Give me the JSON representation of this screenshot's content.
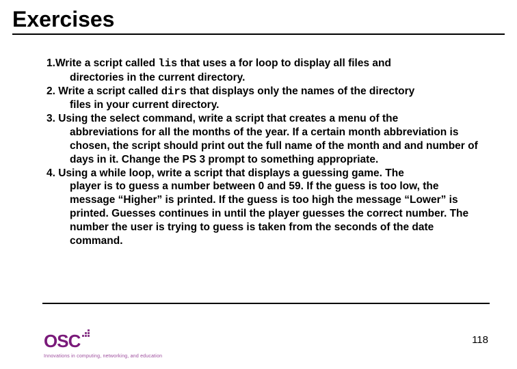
{
  "title": "Exercises",
  "items": [
    {
      "num": "1.",
      "pre": "Write a script called ",
      "code": "lis",
      "post": " that uses a for loop to display all files and",
      "cont": "directories in the current directory."
    },
    {
      "num": "2.",
      "pre": " Write a script called ",
      "code": "dirs",
      "post": " that displays only the names of the directory",
      "cont": "files in your current directory."
    },
    {
      "num": "3.",
      "pre": " Using the select command, write a script that creates a menu of the",
      "code": "",
      "post": "",
      "cont": "abbreviations for all the months of the year. If a certain month abbreviation is chosen, the script should print out the full name of the month and and number of days in it. Change the PS 3 prompt to something appropriate."
    },
    {
      "num": "4.",
      "pre": " Using a while loop, write a script that displays a guessing game. The",
      "code": "",
      "post": "",
      "cont": "player is to guess a number between 0 and 59. If the guess is too low, the message “Higher” is printed. If the guess is too high the message “Lower” is printed. Guesses continues in until the player guesses the correct number. The number the user is trying to guess is taken from the seconds of the date command."
    }
  ],
  "logo": {
    "text": "OSC",
    "tagline": "Innovations in computing, networking, and education"
  },
  "page": "118"
}
